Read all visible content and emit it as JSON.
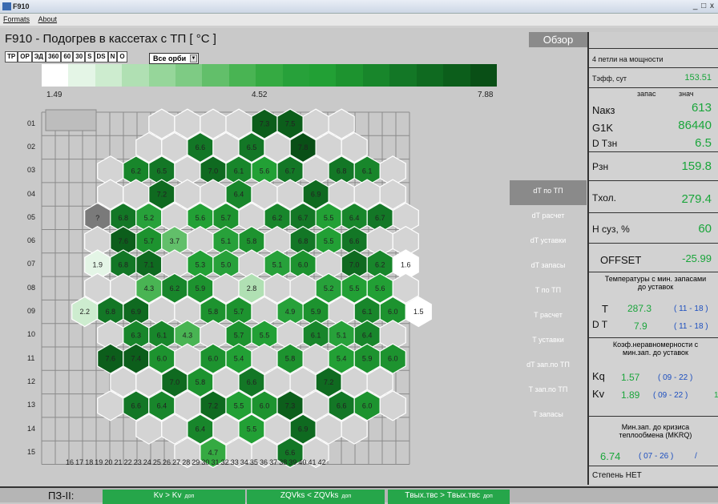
{
  "window": {
    "title": "F910",
    "controls": "_ □ x"
  },
  "menu": {
    "items": [
      "Formats",
      "About"
    ]
  },
  "panel": {
    "title": "F910 - Подогрев в кассетах с ТП [ °C ]",
    "overview_button": "Обзор"
  },
  "modes": [
    "ТР",
    "ОР",
    "ЭД",
    "360",
    "60",
    "30",
    "S",
    "DS",
    "N",
    "O"
  ],
  "orbit_select": {
    "value": "Все орби"
  },
  "scale": {
    "min": "1.49",
    "mid": "4.52",
    "max": "7.88",
    "colors": [
      "#ffffff",
      "#e4f5e6",
      "#cdeccf",
      "#b0e0b3",
      "#96d69a",
      "#7ecb84",
      "#62bf6a",
      "#49b453",
      "#35aa42",
      "#27a13a",
      "#22a035",
      "#1d932f",
      "#18862b",
      "#137726",
      "#0f6a20",
      "#0c5e1b",
      "#094f16"
    ]
  },
  "rows": [
    "01",
    "02",
    "03",
    "04",
    "05",
    "06",
    "07",
    "08",
    "09",
    "10",
    "11",
    "12",
    "13",
    "14",
    "15"
  ],
  "columns": [
    "16",
    "17",
    "18",
    "19",
    "20",
    "21",
    "22",
    "23",
    "24",
    "25",
    "26",
    "27",
    "28",
    "29",
    "30",
    "31",
    "32",
    "33",
    "34",
    "35",
    "36",
    "37",
    "38",
    "39",
    "40",
    "41",
    "42"
  ],
  "hex_map": {
    "01": [
      "",
      "",
      "",
      "",
      "7.3",
      "7.5",
      "",
      ""
    ],
    "02": [
      "",
      "",
      "6.6",
      "",
      "6.5",
      "",
      "7.8",
      "",
      ""
    ],
    "03": [
      "",
      "6.2",
      "6.5",
      "",
      "7.0",
      "6.1",
      "5.6",
      "6.7",
      "",
      "6.8",
      "6.1",
      ""
    ],
    "04": [
      "",
      "",
      "7.2",
      "",
      "",
      "6.4",
      "",
      "",
      "6.9",
      "",
      "",
      ""
    ],
    "05": [
      "?",
      "6.8",
      "5.2",
      "",
      "5.6",
      "5.7",
      "",
      "6.2",
      "6.7",
      "5.5",
      "6.4",
      "6.7",
      ""
    ],
    "06": [
      "",
      "7.6",
      "5.7",
      "3.7",
      "",
      "5.1",
      "5.8",
      "",
      "6.8",
      "5.5",
      "6.6",
      "",
      ""
    ],
    "07": [
      "1.9",
      "6.8",
      "7.1",
      "",
      "5.3",
      "5.0",
      "",
      "5.1",
      "6.0",
      "",
      "7.0",
      "6.2",
      "1.6"
    ],
    "08": [
      "",
      "",
      "4.3",
      "6.2",
      "5.9",
      "",
      "2.8",
      "",
      "",
      "5.2",
      "5.5",
      "5.6",
      ""
    ],
    "09": [
      "2.2",
      "6.8",
      "6.9",
      "",
      "",
      "5.8",
      "5.7",
      "",
      "4.9",
      "5.9",
      "",
      "6.1",
      "6.0",
      "1.5"
    ],
    "10": [
      "",
      "6.3",
      "6.1",
      "4.3",
      "",
      "5.7",
      "5.5",
      "",
      "6.1",
      "5.1",
      "6.4",
      ""
    ],
    "11": [
      "7.6",
      "7.4",
      "6.0",
      "",
      "6.0",
      "5.4",
      "",
      "5.8",
      "",
      "5.4",
      "5.9",
      "6.0"
    ],
    "12": [
      "",
      "",
      "7.0",
      "5.8",
      "",
      "6.6",
      "",
      "",
      "7.2",
      "",
      ""
    ],
    "13": [
      "",
      "6.6",
      "6.4",
      "",
      "7.2",
      "5.5",
      "6.0",
      "7.3",
      "",
      "6.6",
      "6.0",
      ""
    ],
    "14": [
      "",
      "",
      "6.4",
      "",
      "5.5",
      "",
      "6.9",
      "",
      ""
    ],
    "15": [
      "",
      "4.7",
      "",
      "",
      "6.6",
      ""
    ]
  },
  "right_buttons": [
    "dT по ТП",
    "dT расчет",
    "dT уставки",
    "dT запасы",
    "T по ТП",
    "T расчет",
    "T уставки",
    "dT зап.по ТП",
    "T зап.по ТП",
    "T запасы"
  ],
  "status": {
    "loops": "4 петли на мощности",
    "teff_label": "Тэфф, сут",
    "teff_value": "153.51",
    "hdr_reserve": "запас",
    "hdr_value": "знач",
    "naks_label": "Nакз",
    "naks_value": "613",
    "g1k_label": "G1K",
    "g1k_value": "86440",
    "dtzn_label": "D Tзн",
    "dtzn_value": "6.5",
    "pzn_label": "Pзн",
    "pzn_value": "159.8",
    "thol_label": "Tхол.",
    "thol_value": "279.4",
    "hsuz_label": "H суз, %",
    "hsuz_value": "60",
    "offset_label": "OFFSET",
    "offset_value": "-25.99",
    "temps_title": "Температуры с мин. запасами до уставок",
    "t_label": "T",
    "t_value": "287.3",
    "t_pos": "( 11 - 18 )",
    "dt_label": "D T",
    "dt_value": "7.9",
    "dt_pos": "( 11 - 18 )",
    "kq_title": "Коэф.неравномерности с мин.зап. до уставок",
    "kq_label": "Kq",
    "kq_value": "1.57",
    "kq_pos": "( 09 - 22 )",
    "kv_label": "Kv",
    "kv_value": "1.89",
    "kv_pos": "( 09 - 22 )",
    "kv_extra": "1",
    "mkrq_title": "Мин.зап. до кризиса теплообмена (MKRQ)",
    "mkrq_value": "6.74",
    "mkrq_pos": "( 07 - 26 )",
    "mkrq_extra": "/",
    "degree": "Степень НЕТ"
  },
  "bottom": {
    "label": "ПЗ-II:",
    "cells": [
      {
        "main": "Kv > Kv",
        "sub": "доп"
      },
      {
        "main": "ZQVks < ZQVks",
        "sub": "доп"
      },
      {
        "main": "Tвых.твс > Tвых.твс",
        "sub": "доп"
      }
    ]
  }
}
